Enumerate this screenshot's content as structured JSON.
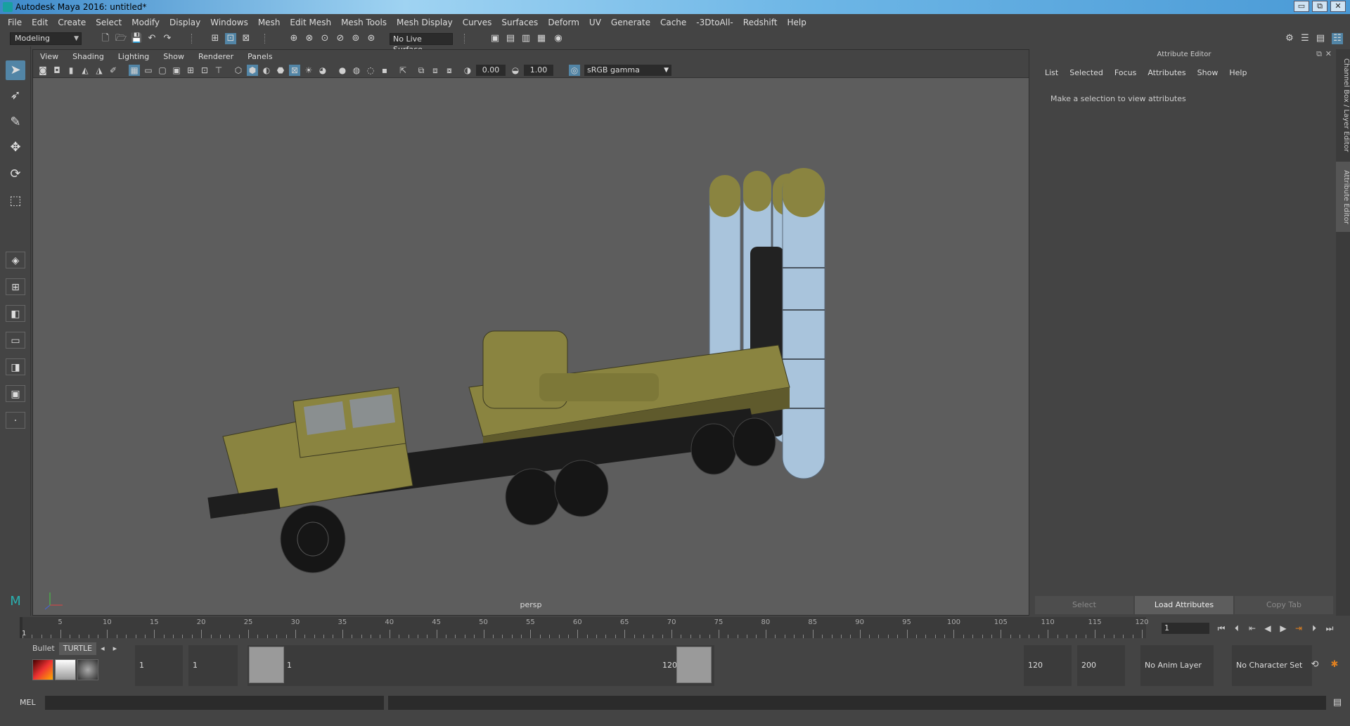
{
  "window": {
    "title": "Autodesk Maya 2016: untitled*",
    "buttons": [
      "▭",
      "⧉",
      "✕"
    ]
  },
  "menubar": [
    "File",
    "Edit",
    "Create",
    "Select",
    "Modify",
    "Display",
    "Windows",
    "Mesh",
    "Edit Mesh",
    "Mesh Tools",
    "Mesh Display",
    "Curves",
    "Surfaces",
    "Deform",
    "UV",
    "Generate",
    "Cache",
    "-3DtoAll-",
    "Redshift",
    "Help"
  ],
  "statusline": {
    "mode": "Modeling",
    "live_surface": "No Live Surface"
  },
  "viewport": {
    "menu": [
      "View",
      "Shading",
      "Lighting",
      "Show",
      "Renderer",
      "Panels"
    ],
    "exposure": "0.00",
    "gamma": "1.00",
    "color_space": "sRGB gamma",
    "camera": "persp"
  },
  "attribute_editor": {
    "title": "Attribute Editor",
    "menu": [
      "List",
      "Selected",
      "Focus",
      "Attributes",
      "Show",
      "Help"
    ],
    "message": "Make a selection to view attributes",
    "buttons": {
      "select": "Select",
      "load": "Load Attributes",
      "copy": "Copy Tab"
    }
  },
  "side_tabs": {
    "channel_box": "Channel Box / Layer Editor",
    "attribute_editor": "Attribute Editor"
  },
  "timeline": {
    "ticks": [
      5,
      10,
      15,
      20,
      25,
      30,
      35,
      40,
      45,
      50,
      55,
      60,
      65,
      70,
      75,
      80,
      85,
      90,
      95,
      100,
      105,
      110,
      115,
      120
    ],
    "current_frame": "1",
    "current_frame_field": "1"
  },
  "shelf": {
    "tabs": [
      "Bullet",
      "TURTLE"
    ]
  },
  "range": {
    "start": "1",
    "playback_start": "1",
    "slider_start": "1",
    "slider_end": "120",
    "playback_end": "120",
    "end": "200",
    "anim_layer": "No Anim Layer",
    "character_set": "No Character Set"
  },
  "cmdline": {
    "label": "MEL"
  }
}
